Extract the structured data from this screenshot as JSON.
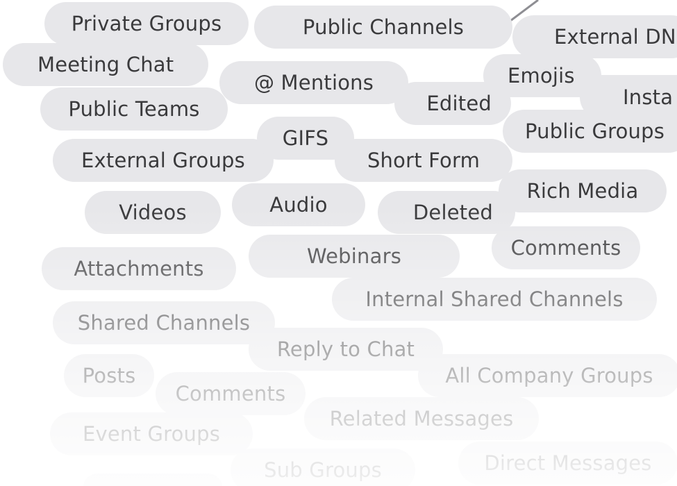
{
  "tags": {
    "private_groups": "Private Groups",
    "public_channels": "Public Channels",
    "external_dm": "External DN",
    "meeting_chat": "Meeting Chat",
    "mentions": "@ Mentions",
    "emojis": "Emojis",
    "insta": "Insta",
    "public_teams": "Public Teams",
    "edited": "Edited",
    "public_groups": "Public Groups",
    "gifs": "GIFS",
    "external_groups": "External Groups",
    "short_form": "Short Form",
    "rich_media": "Rich Media",
    "videos": "Videos",
    "audio": "Audio",
    "deleted": "Deleted",
    "webinars": "Webinars",
    "comments_1": "Comments",
    "attachments": "Attachments",
    "internal_shared_channels": "Internal Shared Channels",
    "shared_channels": "Shared Channels",
    "reply_to_chat": "Reply to Chat",
    "posts": "Posts",
    "all_company_groups": "All Company Groups",
    "comments_2": "Comments",
    "related_messages": "Related Messages",
    "event_groups": "Event Groups",
    "sub_groups": "Sub Groups",
    "direct_messages": "Direct Messages"
  },
  "colors": {
    "pill_background": "#e7e7ea",
    "pill_text": "#3a3a3c",
    "connector": "#8e8e93"
  }
}
